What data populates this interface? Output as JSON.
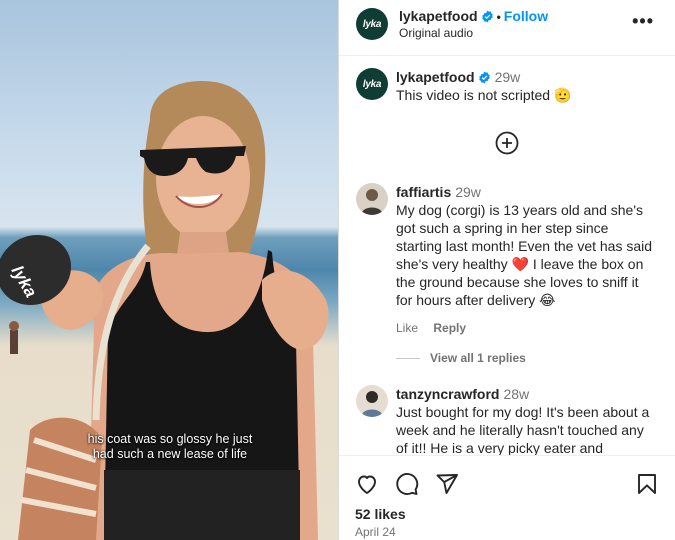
{
  "post": {
    "username": "lykapetfood",
    "follow_label": "Follow",
    "separator": "•",
    "audio": "Original audio",
    "more_label": "•••",
    "avatar_text": "lyka"
  },
  "video": {
    "caption_line1": "his coat was so glossy he just",
    "caption_line2": "had such a new lease of life",
    "mic_text": "lyka"
  },
  "comments": [
    {
      "username": "lykapetfood",
      "time": "29w",
      "text": "This video is not scripted 🫡"
    },
    {
      "username": "faffiartis",
      "time": "29w",
      "text": "My dog (corgi) is 13 years old and she's got such a spring in her step since starting last month! Even the vet has said she's very healthy ❤️ I leave the box on the ground because she loves to sniff it for hours after delivery 😂",
      "like_label": "Like",
      "reply_label": "Reply",
      "view_replies": "View all 1 replies"
    },
    {
      "username": "tanzyncrawford",
      "time": "28w",
      "text": "Just bought for my dog! It's been about a week and he literally hasn't touched any of it!! He is a very picky eater and"
    }
  ],
  "footer": {
    "likes": "52 likes",
    "date": "April 24"
  },
  "icons": {
    "heart": "heart-icon",
    "comment": "comment-icon",
    "share": "share-icon",
    "save": "bookmark-icon",
    "add": "add-circle-icon",
    "verified": "verified-badge-icon"
  },
  "colors": {
    "accent": "#0095f6",
    "brand": "#0f3d33",
    "muted": "#737373"
  }
}
